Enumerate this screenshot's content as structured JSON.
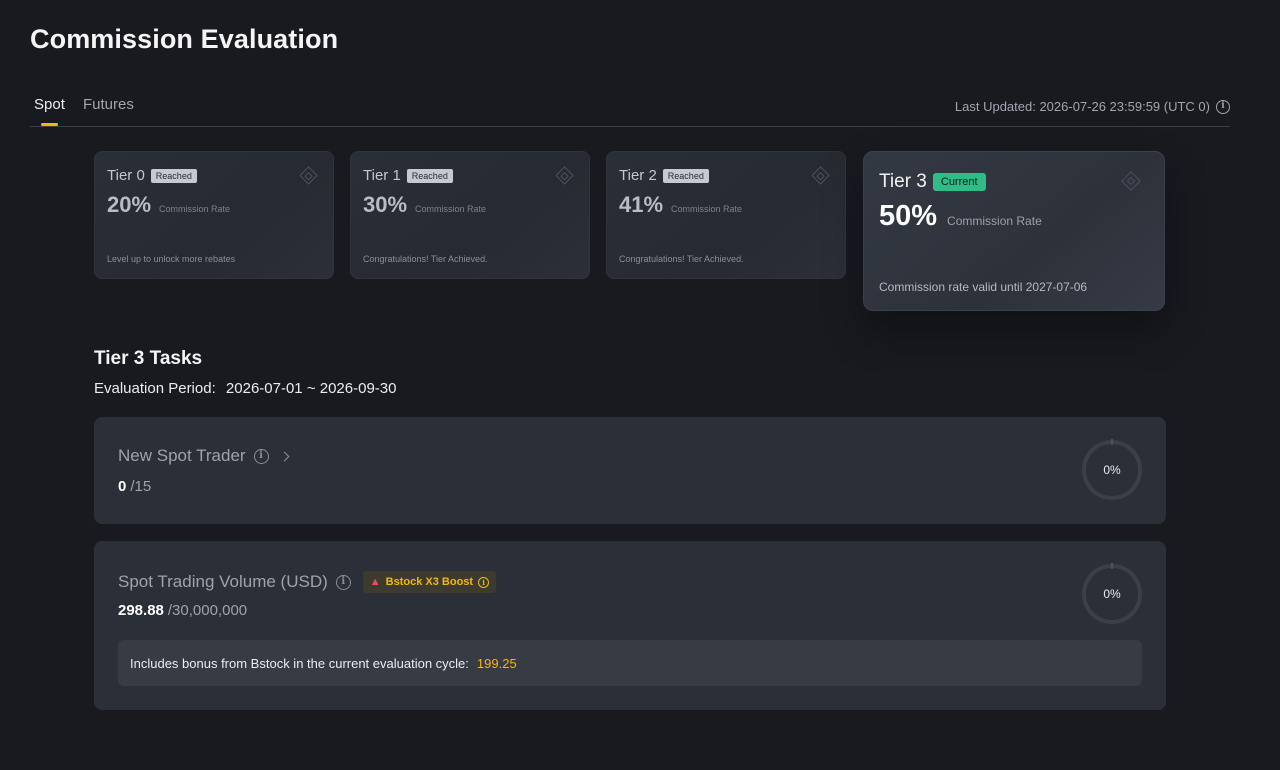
{
  "page": {
    "title": "Commission Evaluation"
  },
  "tabs": [
    {
      "label": "Spot",
      "active": true
    },
    {
      "label": "Futures",
      "active": false
    }
  ],
  "last_updated": "Last Updated: 2026-07-26 23:59:59 (UTC 0)",
  "tiers": [
    {
      "name": "Tier 0",
      "badge": "Reached",
      "rate": "20%",
      "rate_label": "Commission Rate",
      "note": "Level up to unlock more rebates"
    },
    {
      "name": "Tier 1",
      "badge": "Reached",
      "rate": "30%",
      "rate_label": "Commission Rate",
      "note": "Congratulations! Tier Achieved."
    },
    {
      "name": "Tier 2",
      "badge": "Reached",
      "rate": "41%",
      "rate_label": "Commission Rate",
      "note": "Congratulations! Tier Achieved."
    },
    {
      "name": "Tier 3",
      "badge": "Current",
      "rate": "50%",
      "rate_label": "Commission Rate",
      "note": "Commission rate valid until 2027-07-06"
    }
  ],
  "tasks_section": {
    "title": "Tier 3 Tasks",
    "period_label": "Evaluation Period:",
    "period_value": "2026-07-01 ~ 2026-09-30"
  },
  "tasks": [
    {
      "title": "New Spot Trader",
      "current": "0",
      "target": "/15",
      "progress": "0%",
      "progress_value": 0
    },
    {
      "title": "Spot Trading Volume (USD)",
      "boost": "Bstock X3 Boost",
      "current": "298.88",
      "target": "/30,000,000",
      "progress": "0%",
      "progress_value": 0,
      "bonus_text": "Includes bonus from Bstock in the current evaluation cycle:",
      "bonus_value": "199.25"
    }
  ],
  "colors": {
    "accent": "#f0b90b",
    "current_badge": "#2ebd85",
    "fire": "#f6465d"
  },
  "icons": [
    "info-icon",
    "diamond-icon",
    "chevron-right-icon",
    "fire-icon"
  ]
}
